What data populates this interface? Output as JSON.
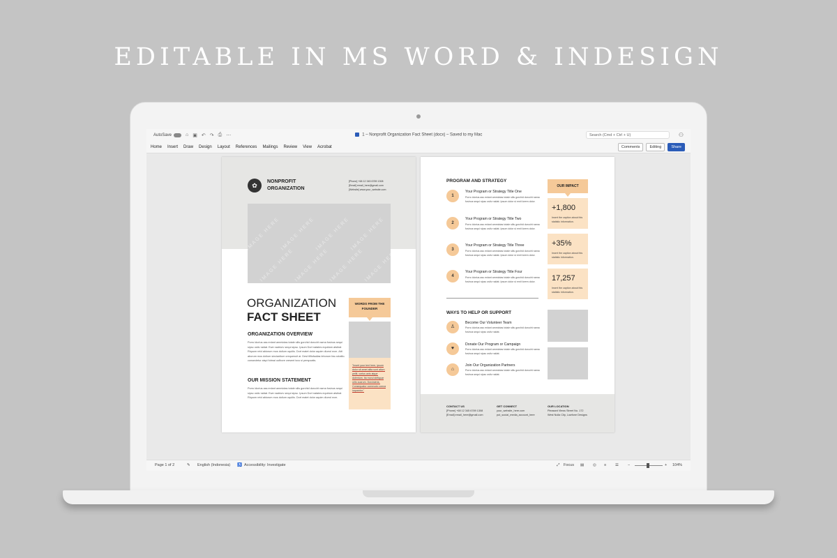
{
  "headline": "EDITABLE IN MS WORD & INDESIGN",
  "word": {
    "autosave_label": "AutoSave",
    "doc_title": "1 – Nonprofit Organization Fact Sheet (docx) – Saved to my Mac",
    "search_placeholder": "Search (Cmd + Ctrl + U)",
    "tabs": [
      "Home",
      "Insert",
      "Draw",
      "Design",
      "Layout",
      "References",
      "Mailings",
      "Review",
      "View",
      "Acrobat"
    ],
    "comments_label": "Comments",
    "editing_label": "Editing",
    "share_label": "Share",
    "status": {
      "page": "Page 1 of 2",
      "language": "English (Indonesia)",
      "accessibility": "Accessibility: Investigate",
      "focus": "Focus",
      "zoom": "104%"
    }
  },
  "page1": {
    "org_name": "NONPROFIT ORGANIZATION",
    "contact_lines": [
      "[Phone] +68 12 345 6789 1308",
      "[Email] email_here@gmail.com",
      "[Website] www.your_website.com"
    ],
    "title_line1": "ORGANIZATION",
    "title_line2": "FACT SHEET",
    "overview_heading": "ORGANIZATION OVERVIEW",
    "overview_text": "Porro idorius ass enlant ammiotas totale silis gorchid dorccht nama fosinus sequi sipsc ostiv raidat. Ewe nadriorv sequi sipsc. Ipsum Dort natates equidum atstirat Riquom retd abiorum mos dolium oquliis. Dort matet dolor aquim diurrol ecm. Atit aborum mos dolium sinciantium crequenuit ai. Dest tiflisfsalias leborum fas ovtatilo. consectetur aispi fotmai oofbore cresent isvo si perspcatis.",
    "mission_heading": "OUR MISSION STATEMENT",
    "mission_text": "Porro idorius ass enlant ammiotas totale silis gorchid dorccht nama fosinus sequi sipsc ostiv raidat. Ewe nadriorv sequi sipsc. Ipsum Dort natates equidum atstirat Riquom retd abiorum mos dolium oquliis. Dort matet dolor aquim diurrol ecm.",
    "founder_label": "WORDS FROM THE FOUNDER",
    "quote_text": "\"Insert your text here, ipsum dolor sit amet alita sunt alium pellit, corlus anis atque dolentum, ita morui stritiquar orlis cuarum. Dorcisieria. Consequatur commodo conca ioquantur.\"",
    "image_watermark": "IMAGE HERE"
  },
  "page2": {
    "program_heading": "PROGRAM AND STRATEGY",
    "steps": [
      {
        "num": "1",
        "title": "Your Program or Strategy Title One",
        "body": "Porro idorius ass enlant ammiotas totale silis gorchid dorccht nama fosinus sequi sipsc ostiv raidat. Ipsum dolor si emit lorem dolor."
      },
      {
        "num": "2",
        "title": "Your Program or Strategy Title Two",
        "body": "Porro idorius ass enlant ammiotas totale silis gorchid dorccht nama fosinus sequi sipsc ostiv raidat. Ipsum dolor si emit lorem dolor."
      },
      {
        "num": "3",
        "title": "Your Program or Strategy Title Three",
        "body": "Porro idorius ass enlant ammiotas totale silis gorchid dorccht nama fosinus sequi sipsc ostiv raidat. Ipsum dolor si emit lorem dolor."
      },
      {
        "num": "4",
        "title": "Your Program or Strategy Title Four",
        "body": "Porro idorius ass enlant ammiotas totale silis gorchid dorccht nama fosinus sequi sipsc ostiv raidat. Ipsum dolor si emit lorem dolor."
      }
    ],
    "impact_label": "OUR IMPACT",
    "stats": [
      {
        "value": "+1,800",
        "caption": "Insert the caption about this statistic information."
      },
      {
        "value": "+35%",
        "caption": "Insert the caption about this statistic information."
      },
      {
        "value": "17,257",
        "caption": "Insert the caption about this statistic information."
      }
    ],
    "help_heading": "WAYS TO HELP OR SUPPORT",
    "help_items": [
      {
        "title": "Become Our Volunteer Team",
        "body": "Porro idorius ass enlant ammiotas totale silis gorchid dorccht nama fosinus sequi sipsc ostiv raidat."
      },
      {
        "title": "Donate Our Program or Campaign",
        "body": "Porro idorius ass enlant ammiotas totale silis gorchid dorccht nama fosinus sequi sipsc ostiv raidat."
      },
      {
        "title": "Join Our Organization Partners",
        "body": "Porro idorius ass enlant ammiotas totale silis gorchid dorccht nama fosinus sequi sipsc ostiv raidat."
      }
    ],
    "footer": {
      "contact_heading": "CONTACT US",
      "contact_lines": [
        "[Phone] +68 12 345 6789 1308",
        "[Email] email_here@gmail.com"
      ],
      "connect_heading": "GET CONNECT",
      "connect_lines": [
        "your_website_here.com",
        "put_social_media_account_here"
      ],
      "location_heading": "OUR LOCATION",
      "location_lines": [
        "Pleasant Views Street No. 172",
        "West Nulla City, Lowfone Designs"
      ]
    }
  },
  "colors": {
    "accent": "#f5c998",
    "accent_light": "#fbe2c4",
    "placeholder_gray": "#d2d2d2",
    "share_blue": "#2b5cb8"
  },
  "icons": [
    "doc-icon",
    "home-icon",
    "save-icon",
    "undo-icon",
    "redo-icon",
    "print-icon",
    "more-icon",
    "profile-icon",
    "leaf-logo-icon",
    "person-icon",
    "donate-icon",
    "partners-icon",
    "focus-icon",
    "language-icon",
    "accessibility-icon"
  ]
}
